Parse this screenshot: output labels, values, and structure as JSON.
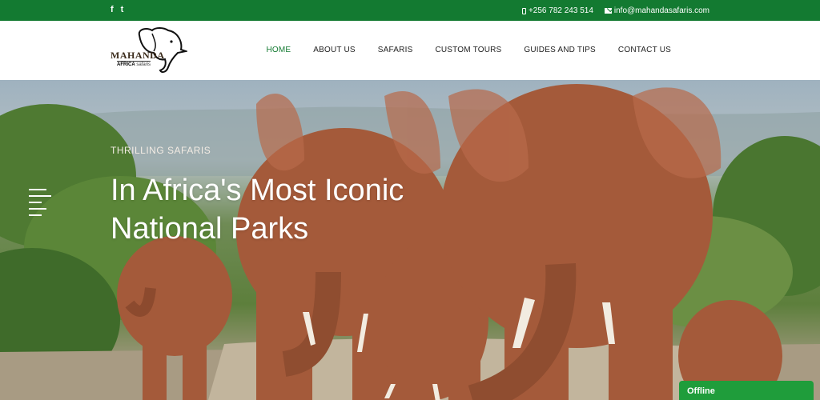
{
  "topbar": {
    "social": [
      {
        "icon": "facebook-icon",
        "glyph": "f"
      },
      {
        "icon": "twitter-icon",
        "glyph": "t"
      }
    ],
    "phone": "+256 782 243 514",
    "email": "info@mahandasafaris.com"
  },
  "logo": {
    "brand": "MAHANDA",
    "sub_bold": "AFRICA",
    "sub_rest": "safaris"
  },
  "nav": {
    "items": [
      {
        "label": "HOME",
        "active": true
      },
      {
        "label": "ABOUT US"
      },
      {
        "label": "SAFARIS"
      },
      {
        "label": "CUSTOM TOURS"
      },
      {
        "label": "GUIDES AND TIPS"
      },
      {
        "label": "CONTACT US"
      }
    ]
  },
  "hero": {
    "kicker": "THRILLING SAFARIS",
    "title_line1": "In Africa's Most Iconic",
    "title_line2": "National Parks"
  },
  "chat": {
    "status": "Offline"
  },
  "colors": {
    "brand_green": "#137a31",
    "chat_green": "#1f9d3b"
  }
}
